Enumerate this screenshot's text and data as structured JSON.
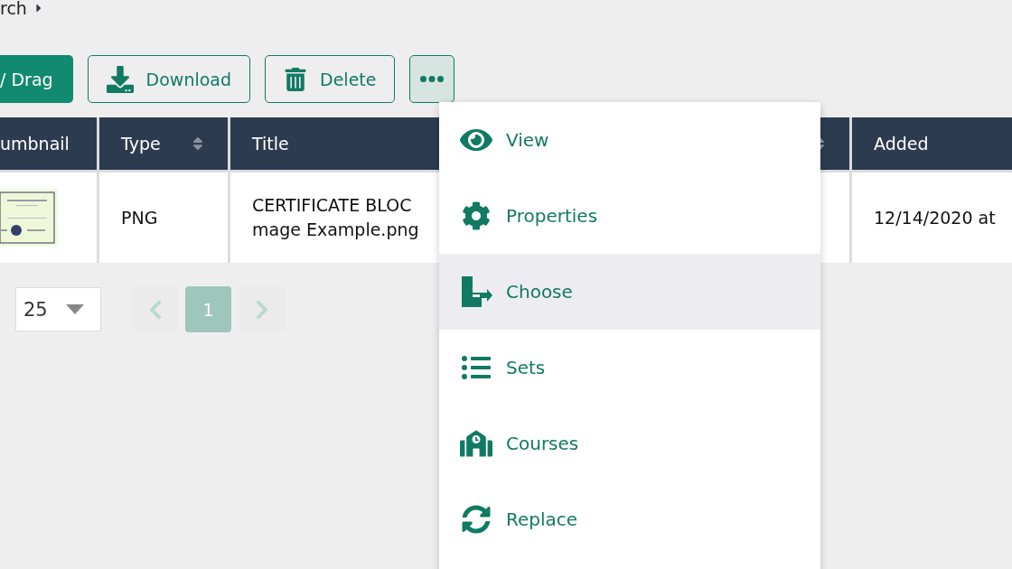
{
  "breadcrumb": {
    "text": "rch"
  },
  "toolbar": [
    {
      "label": "/ Drag",
      "kind": "primary"
    },
    {
      "label": "Download",
      "kind": "outline"
    },
    {
      "label": "Delete",
      "kind": "outline"
    },
    {
      "kind": "more",
      "expanded": true
    }
  ],
  "table": {
    "columns": [
      {
        "label": "umbnail",
        "sortable": false
      },
      {
        "label": "Type",
        "sortable": true
      },
      {
        "label": "Title"
      },
      {
        "sortable": true
      },
      {
        "label": "Added"
      }
    ],
    "rows": [
      {
        "cells": [
          {
            "kind": "picture"
          },
          {
            "kind": "text",
            "text": "PNG"
          },
          {
            "kind": "lines",
            "lines": [
              "CERTIFICATE BLOC",
              "mage Example.png"
            ]
          },
          {
            "kind": "empty"
          },
          {
            "kind": "text",
            "text": "12/14/2020 at"
          }
        ]
      }
    ]
  },
  "pagination": {
    "page_size": "25",
    "prev": {
      "disabled": true
    },
    "pages": [
      {
        "label": "1",
        "selected": true
      }
    ],
    "next": {
      "disabled": true
    }
  },
  "menu": [
    {
      "label": "View",
      "hovered": false
    },
    {
      "label": "Properties",
      "hovered": false
    },
    {
      "label": "Choose",
      "hovered": true
    },
    {
      "label": "Sets",
      "hovered": false
    },
    {
      "label": "Courses",
      "hovered": false
    },
    {
      "label": "Replace",
      "hovered": false
    }
  ]
}
